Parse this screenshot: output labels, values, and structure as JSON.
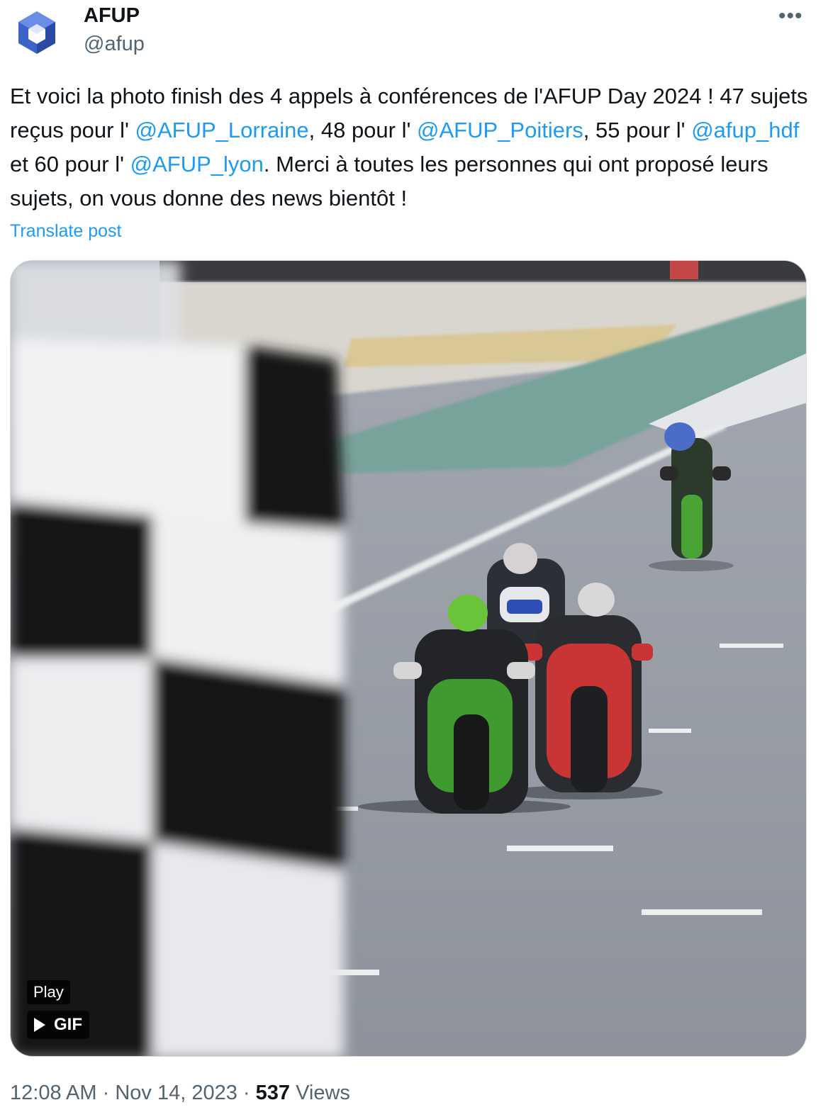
{
  "account": {
    "name": "AFUP",
    "handle": "@afup",
    "avatar_icon": "afup-cube-logo"
  },
  "more_icon": "more-dots-icon",
  "post": {
    "segments": [
      {
        "text": "Et voici la photo finish des 4 appels à conférences de l'AFUP Day 2024 ! 47 sujets reçus pour l' ",
        "mention": false
      },
      {
        "text": "@AFUP_Lorraine",
        "mention": true
      },
      {
        "text": ", 48 pour l' ",
        "mention": false
      },
      {
        "text": "@AFUP_Poitiers",
        "mention": true
      },
      {
        "text": ", 55 pour l' ",
        "mention": false
      },
      {
        "text": "@afup_hdf",
        "mention": true
      },
      {
        "text": " et 60 pour l' ",
        "mention": false
      },
      {
        "text": "@AFUP_lyon",
        "mention": true
      },
      {
        "text": ". Merci à toutes les personnes qui ont proposé leurs sujets, on vous donne des news bientôt !",
        "mention": false
      }
    ],
    "translate_label": "Translate post"
  },
  "media": {
    "play_label": "Play",
    "gif_label": "GIF",
    "play_icon": "play-triangle-icon"
  },
  "meta": {
    "time": "12:08 AM",
    "date": "Nov 14, 2023",
    "views_count": "537",
    "views_label": "Views",
    "separator": "·"
  },
  "colors": {
    "link": "#1d9bf0",
    "secondary_text": "#536471",
    "primary_text": "#0f1419"
  }
}
